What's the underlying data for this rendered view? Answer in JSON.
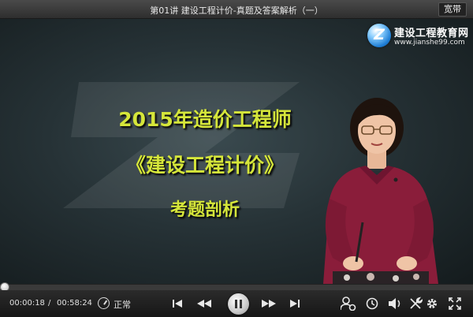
{
  "titlebar": {
    "title": "第01讲    建设工程计价-真题及答案解析（一）",
    "bandwidth_label": "宽带"
  },
  "logo": {
    "letter": "Z",
    "name": "建设工程教育网",
    "url": "www.jianshe99.com"
  },
  "slide": {
    "line1": "2015年造价工程师",
    "line2": "《建设工程计价》",
    "line3": "考题剖析"
  },
  "player": {
    "current_time": "00:00:18",
    "separator": "/",
    "total_time": "00:58:24",
    "speed_label": "正常",
    "progress": 0.006
  },
  "colors": {
    "headline": "#d5e63a",
    "logo_blue": "#1f7fd6"
  },
  "icons": [
    "speed-icon",
    "previous-icon",
    "rewind-icon",
    "pause-icon",
    "fast-forward-icon",
    "next-icon",
    "user-settings-icon",
    "clock-icon",
    "volume-icon",
    "tools-icon",
    "gear-icon",
    "fullscreen-icon"
  ]
}
